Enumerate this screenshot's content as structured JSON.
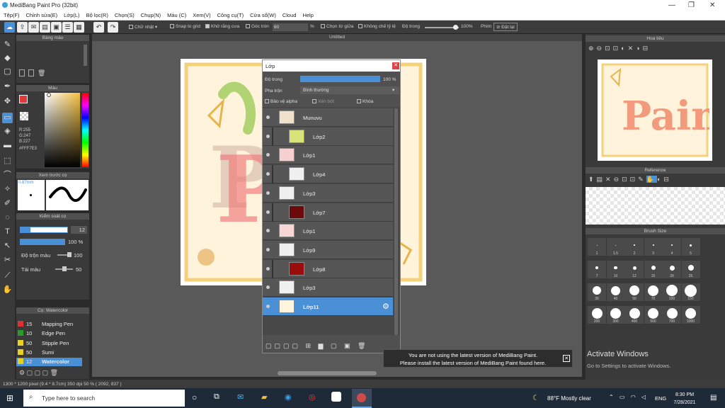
{
  "window": {
    "title": "MediBang Paint Pro (32bit)",
    "min": "—",
    "max": "❐",
    "close": "✕"
  },
  "menu": [
    "Tệp(F)",
    "Chỉnh sửa(E)",
    "Lớp(L)",
    "Bộ lọc(R)",
    "Chọn(S)",
    "Chụp(N)",
    "Màu (C)",
    "Xem(V)",
    "Công cụ(T)",
    "Cửa sổ(W)",
    "Cloud",
    "Help"
  ],
  "toolbar": {
    "shape_select": "Chữ nhật",
    "snap_grid": "Snap to grid",
    "antialias": "Khử răng cưa",
    "corner": "Góc tròn",
    "corner_value": "60",
    "percent": "%",
    "center_choose": "Chọn từ giữa",
    "no_ratio": "Không chế tỷ lệ",
    "opacity_label": "Độ trong",
    "opacity_value": "100%",
    "finger": "Phím",
    "reset": "Đặt lại"
  },
  "panels": {
    "palette": "Bảng màu",
    "color": "Màu",
    "preview": "Xem trước cọ",
    "control": "Kiểm soát cọ",
    "brush": "Cọ: Watercolor",
    "navigator": "Hoa tiêu",
    "reference": "Reference",
    "brushsize": "Brush Size"
  },
  "color": {
    "r": "R:255",
    "g": "G:247",
    "b": "B:227",
    "hex": "#FFF7E3",
    "fg": "#e23a3a",
    "bg": "#ffffff"
  },
  "preview": {
    "size": "0.87mm"
  },
  "control": {
    "size": "12",
    "opacity": "100 %",
    "blend_label": "Độ trộn màu",
    "blend_value": "100",
    "reload_label": "Tải màu",
    "reload_value": "50"
  },
  "brushes": [
    {
      "size": "15",
      "name": "Mapping Pen",
      "color": "#e03030"
    },
    {
      "size": "10",
      "name": "Edge Pen",
      "color": "#2a9a2a"
    },
    {
      "size": "50",
      "name": "Stipple Pen",
      "color": "#e8d020"
    },
    {
      "size": "50",
      "name": "Sumi",
      "color": "#e8d020"
    },
    {
      "size": "12",
      "name": "Watercolor",
      "color": "#e8d020"
    }
  ],
  "canvas_tab": "Untitled",
  "layers_window": {
    "title": "Lớp",
    "opacity_label": "Độ trong",
    "opacity_value": "100 %",
    "blend_label": "Pha trộn",
    "blend_value": "Bình thường",
    "protect_alpha": "Bảo vệ alpha",
    "clipping": "Xén bớt",
    "lock": "Khóa"
  },
  "layers": [
    {
      "name": "Munuvu",
      "thumb": "#efe2c8",
      "indent": false
    },
    {
      "name": "Lớp2",
      "thumb": "#d8e47a",
      "indent": true
    },
    {
      "name": "Lớp1",
      "thumb": "#f6d0d0",
      "indent": false
    },
    {
      "name": "Lớp4",
      "thumb": "#f0f0f0",
      "indent": true
    },
    {
      "name": "Lớp3",
      "thumb": "#f0f0f0",
      "indent": false
    },
    {
      "name": "Lớp7",
      "thumb": "#6a0a0a",
      "indent": true
    },
    {
      "name": "Lớp1",
      "thumb": "#f7d6d6",
      "indent": false
    },
    {
      "name": "Lớp9",
      "thumb": "#f0f0f0",
      "indent": false
    },
    {
      "name": "Lớp8",
      "thumb": "#9a0d0d",
      "indent": true
    },
    {
      "name": "Lớp3",
      "thumb": "#f0f0f0",
      "indent": false
    },
    {
      "name": "Lớp11",
      "thumb": "#fff5de",
      "indent": false,
      "selected": true
    }
  ],
  "brush_sizes": [
    "1",
    "1.5",
    "2",
    "3",
    "4",
    "5",
    "7",
    "10",
    "12",
    "15",
    "20",
    "25",
    "30",
    "40",
    "50",
    "70",
    "100",
    "150",
    "200",
    "300",
    "400",
    "500",
    "700",
    "1000"
  ],
  "status": "1300 * 1200 pixel   (9.4 * 8.7cm)  350 dpi  50 %   ( 2092, 837 )",
  "notification": {
    "line1": "You are not using the latest version of MediBang Paint.",
    "line2": "Please install the latest version of MediBang Paint found here."
  },
  "activate": {
    "title": "Activate Windows",
    "sub": "Go to Settings to activate Windows."
  },
  "taskbar": {
    "search": "Type here to search",
    "weather": "88°F  Mostly clear",
    "lang": "ENG",
    "time": "8:30 PM",
    "date": "7/28/2021"
  }
}
